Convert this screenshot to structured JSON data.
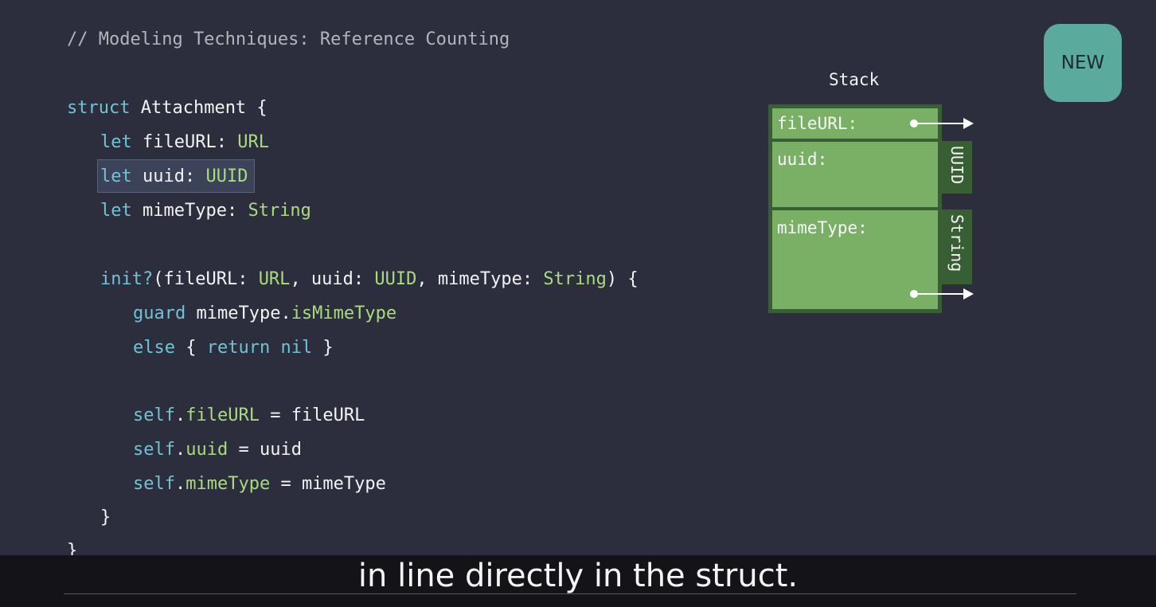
{
  "code": {
    "comment": "// Modeling Techniques: Reference Counting",
    "struct_kw": "struct",
    "struct_name": " Attachment {",
    "let_kw": "let",
    "prop1_name": " fileURL: ",
    "prop1_type": "URL",
    "prop2_name": " uuid: ",
    "prop2_type": "UUID",
    "prop3_name": " mimeType: ",
    "prop3_type": "String",
    "init_kw": "init?",
    "init_args_1": "(fileURL: ",
    "init_type_1": "URL",
    "init_args_2": ", uuid: ",
    "init_type_2": "UUID",
    "init_args_3": ", mimeType: ",
    "init_type_3": "String",
    "init_args_4": ") {",
    "guard_kw": "guard",
    "guard_expr": " mimeType.",
    "guard_method": "isMimeType",
    "else_kw": "else",
    "else_open": " { ",
    "return_kw": "return nil",
    "else_close": " }",
    "self_kw": "self",
    "dot": ".",
    "assign1_prop": "fileURL",
    "assign1_rhs": " = fileURL",
    "assign2_prop": "uuid",
    "assign2_rhs": " = uuid",
    "assign3_prop": "mimeType",
    "assign3_rhs": " = mimeType",
    "close_init": "}",
    "close_struct": "}"
  },
  "badge": {
    "label": "NEW"
  },
  "stack": {
    "title": "Stack",
    "cells": [
      "fileURL:",
      "uuid:",
      "mimeType:"
    ],
    "uuid_tab": "UUID",
    "string_tab": "String"
  },
  "subtitle": {
    "text": "in line directly in the struct."
  },
  "colors": {
    "background": "#2d2e3d",
    "keyword": "#6fc3d6",
    "type": "#a8dc7c",
    "cell_green": "#79b065",
    "badge": "#5aab9d"
  }
}
